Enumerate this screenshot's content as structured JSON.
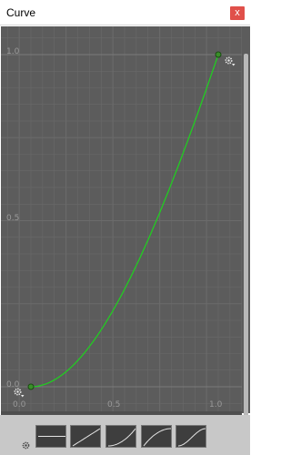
{
  "window": {
    "title": "Curve",
    "close_label": "x"
  },
  "axes": {
    "x_ticks": [
      "0.0",
      "0.5",
      "1.0"
    ],
    "y_ticks": [
      "0.0",
      "0.5",
      "1.0"
    ]
  },
  "curve": {
    "color": "#22cc22",
    "key_color": "#3a8f2a",
    "keys": [
      {
        "time": 0.0,
        "value": 0.0
      },
      {
        "time": 1.0,
        "value": 1.0
      }
    ],
    "shape": "ease-in"
  },
  "icons": {
    "key_menu": "gear-dropdown-icon",
    "presets_menu": "gear-icon"
  },
  "presets": [
    {
      "name": "constant"
    },
    {
      "name": "linear"
    },
    {
      "name": "ease-in"
    },
    {
      "name": "ease-out"
    },
    {
      "name": "ease-in-out"
    }
  ],
  "colors": {
    "graph_background": "#5c5c5c",
    "grid_line": "#6b6b6b",
    "bottom_bar": "#c8c8c8",
    "close_button": "#e0504a"
  }
}
